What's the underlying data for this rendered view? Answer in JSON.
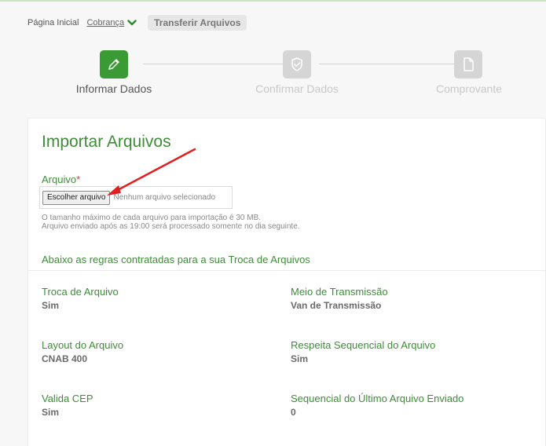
{
  "breadcrumb": {
    "home": "Página Inicial",
    "section": "Cobrança",
    "current": "Transferir Arquivos"
  },
  "stepper": {
    "steps": [
      {
        "label": "Informar Dados",
        "icon": "pencil-icon",
        "state": "active"
      },
      {
        "label": "Confirmar Dados",
        "icon": "shield-check-icon",
        "state": "inactive"
      },
      {
        "label": "Comprovante",
        "icon": "document-icon",
        "state": "inactive"
      }
    ]
  },
  "card": {
    "title": "Importar Arquivos",
    "field_label": "Arquivo",
    "required_mark": "*",
    "file_button": "Escolher arquivo",
    "file_status": "Nenhum arquivo selecionado",
    "help_line1": "O tamanho máximo de cada arquivo para importação é 30 MB.",
    "help_line2": "Arquivo enviado após as 19:00 será processado somente no dia seguinte.",
    "rules_title": "Abaixo as regras contratadas para a sua Troca de Arquivos"
  },
  "rules": [
    {
      "label": "Troca de Arquivo",
      "value": "Sim"
    },
    {
      "label": "Meio de Transmissão",
      "value": "Van de Transmissão"
    },
    {
      "label": "Layout do Arquivo",
      "value": "CNAB 400"
    },
    {
      "label": "Respeita Sequencial do Arquivo",
      "value": "Sim"
    },
    {
      "label": "Valida CEP",
      "value": "Sim"
    },
    {
      "label": "Sequencial do Último Arquivo Enviado",
      "value": "0"
    }
  ],
  "colors": {
    "brand_green": "#3d8d37",
    "step_active": "#3a9b35",
    "step_inactive": "#d5d5d5",
    "annotation_arrow": "#e02020"
  }
}
